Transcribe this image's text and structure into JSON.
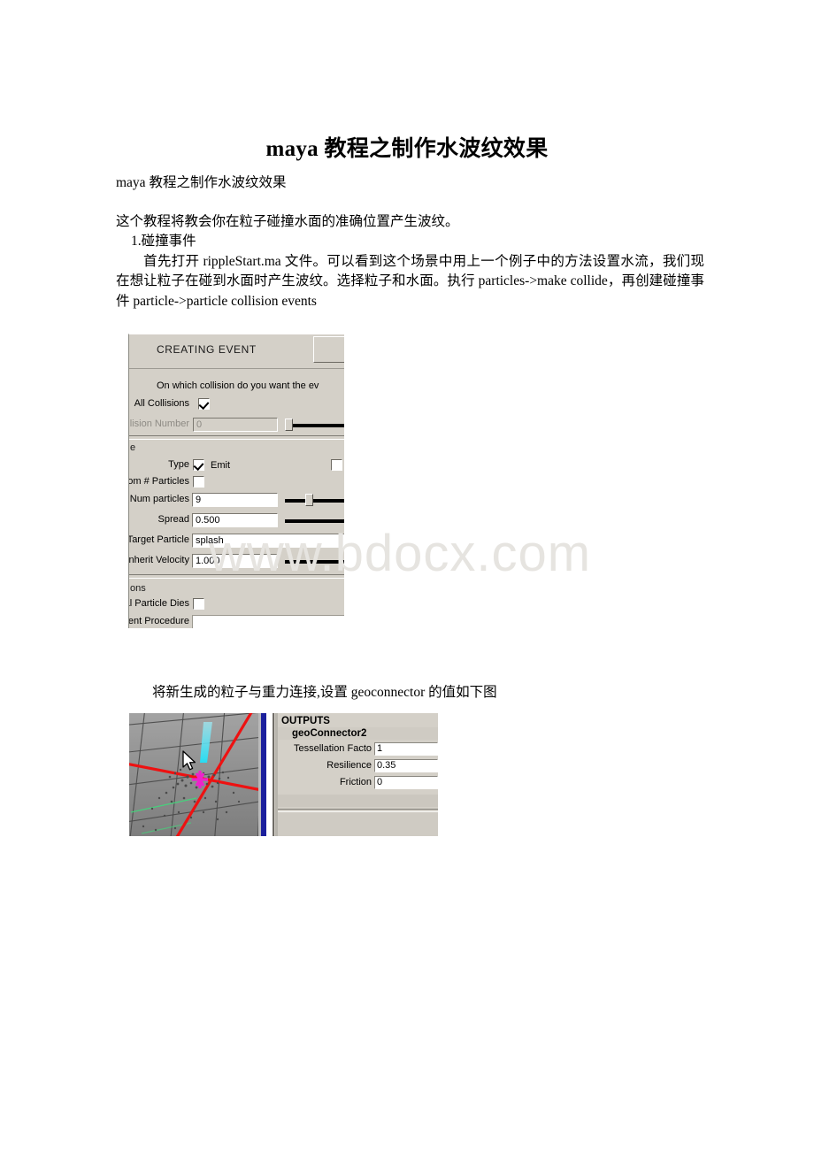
{
  "document": {
    "title": "maya 教程之制作水波纹效果",
    "subtitle": "maya 教程之制作水波纹效果",
    "intro": "这个教程将教会你在粒子碰撞水面的准确位置产生波纹。",
    "section_heading": "1.碰撞事件",
    "paragraph": "首先打开 rippleStart.ma 文件。可以看到这个场景中用上一个例子中的方法设置水流，我们现在想让粒子在碰到水面时产生波纹。选择粒子和水面。执行 particles->make collide，再创建碰撞事件 particle->particle collision events",
    "caption": "将新生成的粒子与重力连接,设置 geoconnector 的值如下图",
    "watermark": "www.bdocx.com"
  },
  "figure_event": {
    "section_title": "CREATING EVENT",
    "question": "On which collision do you want the ev",
    "all_collisions": {
      "label": "All Collisions",
      "checked": true
    },
    "collision_number": {
      "label": "Collision Number",
      "value": "0",
      "disabled": true
    },
    "group_event_type": "e",
    "type": {
      "label": "Type",
      "checkbox_label": "Emit",
      "checked": true
    },
    "random_particles": {
      "label": "ndom # Particles",
      "checked": false
    },
    "num_particles": {
      "label": "Num particles",
      "value": "9"
    },
    "spread": {
      "label": "Spread",
      "value": "0.500"
    },
    "target_particle": {
      "label": "Target Particle",
      "value": "splash"
    },
    "inherit_velocity": {
      "label": "Inherit Velocity",
      "value": "1.000"
    },
    "group_options": "ons",
    "original_particle_dies": {
      "label": "inal Particle Dies",
      "checked": false
    },
    "event_procedure": {
      "label": "Event Procedure",
      "value": ""
    }
  },
  "figure_geoconnector": {
    "outputs_label": "OUTPUTS",
    "node_name": "geoConnector2",
    "attributes": [
      {
        "label": "Tessellation Facto",
        "value": "1"
      },
      {
        "label": "Resilience",
        "value": "0.35"
      },
      {
        "label": "Friction",
        "value": "0"
      }
    ]
  },
  "colors": {
    "panel_bg": "#d4d0c8",
    "field_bg": "#ffffff",
    "viewport_bg": "#8e8e8e",
    "axis_red": "#ee1111",
    "axis_green": "#3ddc7a",
    "locator_magenta": "#ee22cc",
    "manipulator_cyan": "#3fe0f0",
    "ae_edge_blue": "#1b1f9c"
  }
}
